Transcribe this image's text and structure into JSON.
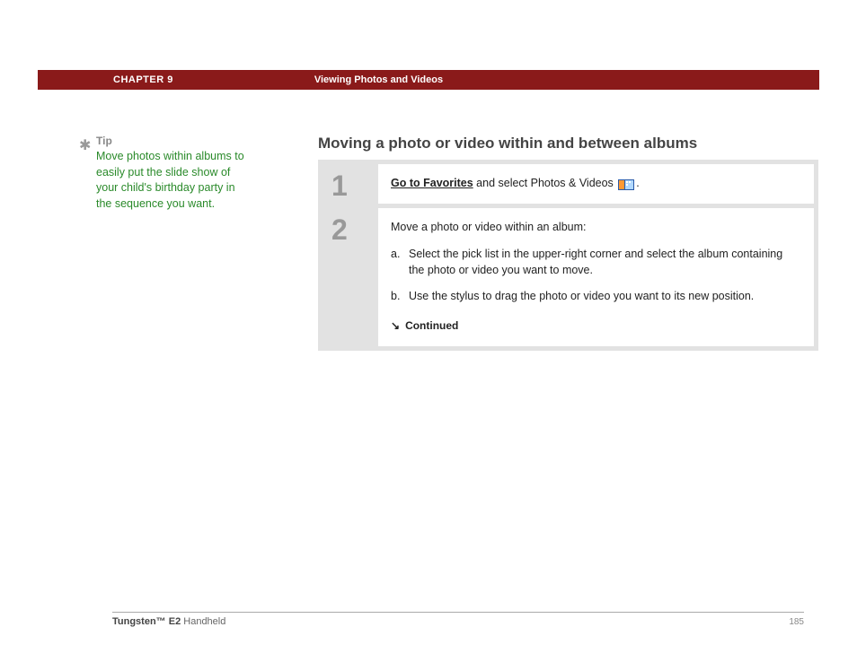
{
  "header": {
    "chapter_label": "CHAPTER 9",
    "chapter_title": "Viewing Photos and Videos"
  },
  "tip": {
    "label": "Tip",
    "text": "Move photos within albums to easily put the slide show of your child's birthday party in the sequence you want."
  },
  "main": {
    "title": "Moving a photo or video within and between albums",
    "steps": [
      {
        "number": "1",
        "link_text": "Go to Favorites",
        "rest_text": " and select Photos & Videos ",
        "end_text": "."
      },
      {
        "number": "2",
        "intro": "Move a photo or video within an album:",
        "subs": [
          {
            "letter": "a.",
            "text": "Select the pick list in the upper-right corner and select the album containing the photo or video you want to move."
          },
          {
            "letter": "b.",
            "text": "Use the stylus to drag the photo or video you want to its new position."
          }
        ],
        "continued": "Continued"
      }
    ]
  },
  "footer": {
    "product_bold": "Tungsten™ E2",
    "product_rest": " Handheld",
    "page_number": "185"
  }
}
